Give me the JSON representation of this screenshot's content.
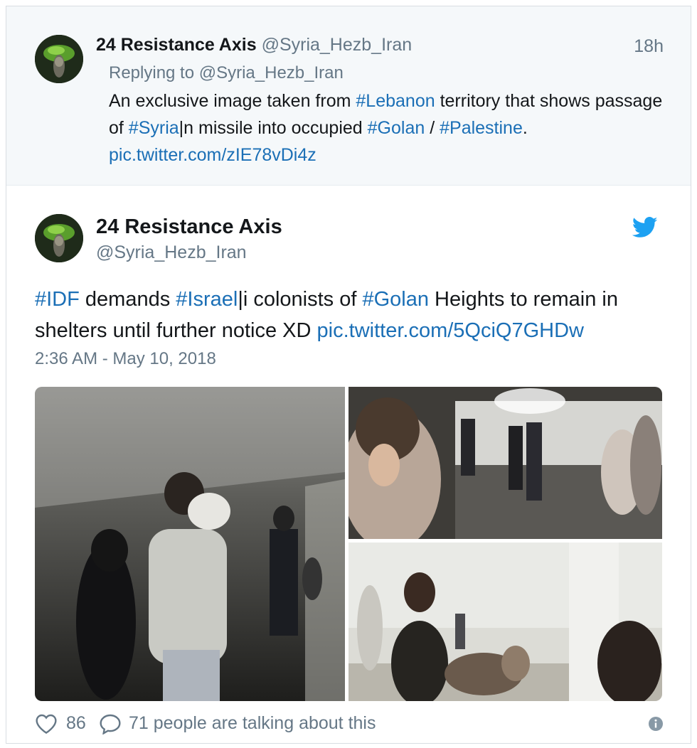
{
  "reply_tweet": {
    "name": "24 Resistance Axis",
    "handle": "@Syria_Hezb_Iran",
    "time_ago": "18h",
    "replying_to": "Replying to @Syria_Hezb_Iran",
    "text_1": "An exclusive image taken from ",
    "tag_lebanon": "#Lebanon",
    "text_2": " territory that shows passage of ",
    "tag_syria": "#Syria",
    "text_3": "|n missile into occupied ",
    "tag_golan": "#Golan",
    "text_4": " / ",
    "tag_palestine": "#Palestine",
    "text_5": ".",
    "link": "pic.twitter.com/zIE78vDi4z"
  },
  "main_tweet": {
    "name": "24 Resistance Axis",
    "handle": "@Syria_Hezb_Iran",
    "tag_idf": "#IDF",
    "text_1": " demands ",
    "tag_israel": "#Israel",
    "text_2": "|i colonists of ",
    "tag_golan": "#Golan",
    "text_3": " Heights to remain in shelters until further notice XD ",
    "link": "pic.twitter.com/5QciQ7GHDw",
    "timestamp": "2:36 AM - May 10, 2018"
  },
  "footer": {
    "likes": "86",
    "talking": "71 people are talking about this"
  },
  "icons": {
    "like": "heart-icon",
    "reply": "speech-bubble-icon",
    "info": "info-icon",
    "brand": "twitter-bird-icon"
  },
  "colors": {
    "link": "#1b6fb6",
    "muted": "#657786",
    "twitter_blue": "#1da1f2",
    "reply_bg": "#f5f8fa"
  }
}
